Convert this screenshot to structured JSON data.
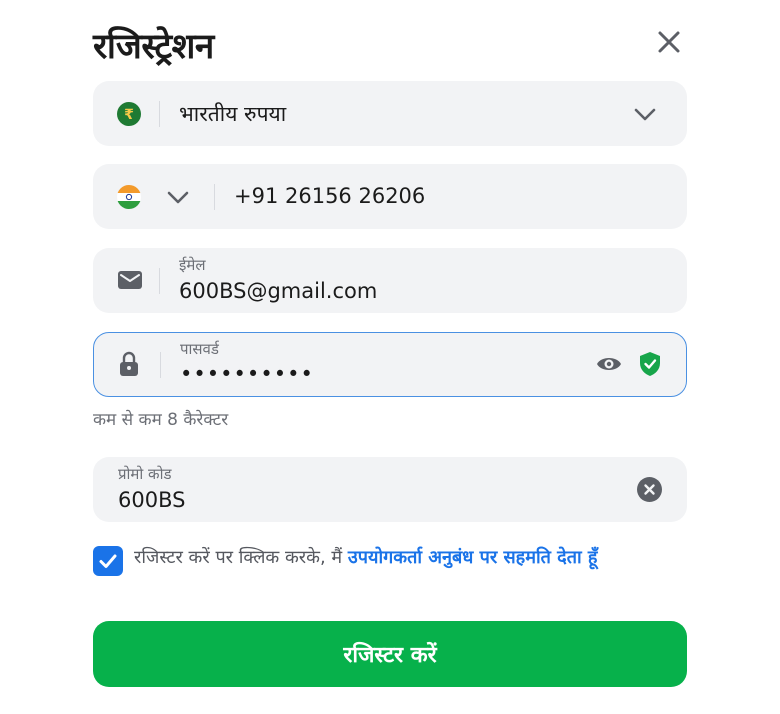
{
  "title": "रजिस्ट्रेशन",
  "icons": {
    "close": "close-icon",
    "currency": "rupee-icon",
    "chevron": "chevron-down-icon",
    "flag": "india-flag-icon",
    "email": "envelope-icon",
    "lock": "lock-icon",
    "eye": "eye-icon",
    "shield": "shield-check-icon",
    "clear": "clear-icon",
    "check": "check-icon"
  },
  "currency": {
    "value": "भारतीय रुपया"
  },
  "phone": {
    "value": "+91 26156 26206"
  },
  "email": {
    "label": "ईमेल",
    "value": "600BS@gmail.com"
  },
  "password": {
    "label": "पासवर्ड",
    "masked_value": "••••••••••",
    "hint": "कम से कम 8 कैरेक्टर"
  },
  "promo": {
    "label": "प्रोमो कोड",
    "value": "600BS"
  },
  "terms": {
    "checked": true,
    "text": "रजिस्टर करें पर क्लिक करके, मैं ",
    "link": "उपयोगकर्ता अनुबंध पर सहमति देता हूँ"
  },
  "submit_label": "रजिस्टर करें",
  "colors": {
    "accent": "#1a73e8",
    "button": "#07b14b",
    "shield": "#17a54a",
    "rupee": "#1f7a33",
    "field_bg": "#f2f3f5",
    "active_border": "#4a90e2"
  }
}
